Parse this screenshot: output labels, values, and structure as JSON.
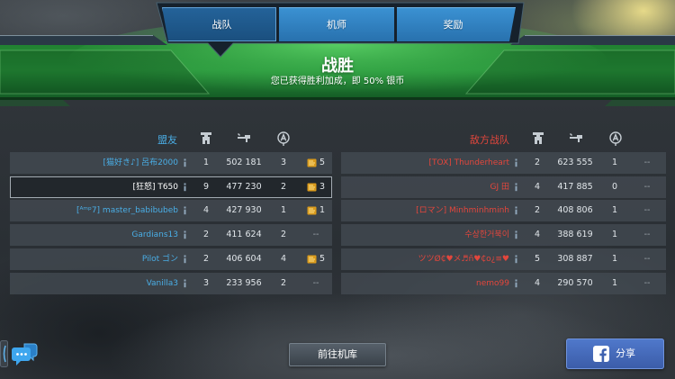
{
  "tabs": [
    {
      "label": "战队",
      "active": true
    },
    {
      "label": "机师",
      "active": false
    },
    {
      "label": "奖励",
      "active": false
    }
  ],
  "banner": {
    "title": "战胜",
    "subtitle": "您已获得胜利加成，即 50% 银币"
  },
  "allies": {
    "label": "盟友",
    "rows": [
      {
        "name": "[猫好き♪] 呂布2000",
        "robots": 1,
        "damage": "502 181",
        "rank": 3,
        "bonus": "5",
        "is_player": false
      },
      {
        "name": "[狂怒] T650",
        "robots": 9,
        "damage": "477 230",
        "rank": 2,
        "bonus": "3",
        "is_player": true
      },
      {
        "name": "[ᴬᵐᵖ7] master_babibubeb",
        "robots": 4,
        "damage": "427 930",
        "rank": 1,
        "bonus": "1",
        "is_player": false
      },
      {
        "name": "Gardians13",
        "robots": 2,
        "damage": "411 624",
        "rank": 2,
        "bonus": "--",
        "is_player": false
      },
      {
        "name": "Pilot ゴン",
        "robots": 2,
        "damage": "406 604",
        "rank": 4,
        "bonus": "5",
        "is_player": false
      },
      {
        "name": "Vanilla3",
        "robots": 3,
        "damage": "233 956",
        "rank": 2,
        "bonus": "--",
        "is_player": false
      }
    ]
  },
  "enemies": {
    "label": "敌方战队",
    "rows": [
      {
        "name": "[TOX] Thunderheart",
        "robots": 2,
        "damage": "623 555",
        "rank": 1,
        "bonus": "--"
      },
      {
        "name": "GJ 田",
        "robots": 4,
        "damage": "417 885",
        "rank": 0,
        "bonus": "--"
      },
      {
        "name": "[ロマン] Minhminhminh",
        "robots": 2,
        "damage": "408 806",
        "rank": 1,
        "bonus": "--"
      },
      {
        "name": "수상한거북이",
        "robots": 4,
        "damage": "388 619",
        "rank": 1,
        "bonus": "--"
      },
      {
        "name": "ツツØ₵♥メ♬ñ♥₵o¿≡♥",
        "robots": 5,
        "damage": "308 887",
        "rank": 1,
        "bonus": "--"
      },
      {
        "name": "nemo99",
        "robots": 4,
        "damage": "290 570",
        "rank": 1,
        "bonus": "--"
      }
    ]
  },
  "buttons": {
    "hangar": "前往机库",
    "share": "分享"
  },
  "icons": {
    "columns": [
      "robot-icon",
      "weapon-icon",
      "beacon-icon"
    ],
    "info": "info-icon",
    "bonus": "gold-icon",
    "chat": "chat-icon",
    "share": "facebook-icon"
  },
  "colors": {
    "ally": "#4aaee6",
    "enemy": "#e3463c",
    "self": "#ffffff"
  }
}
